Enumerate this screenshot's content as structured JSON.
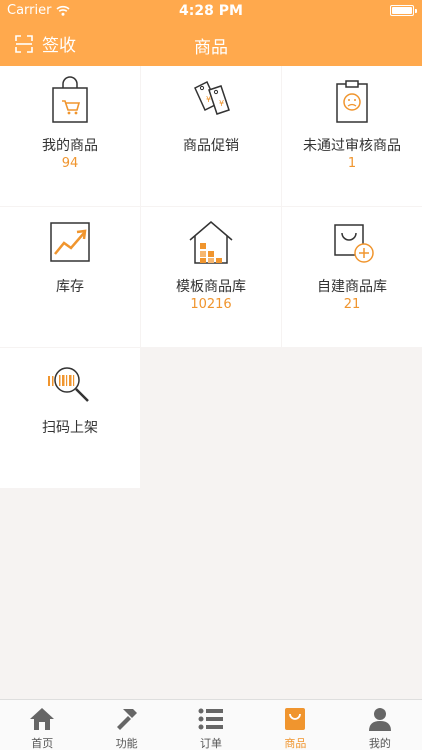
{
  "status_bar": {
    "carrier": "Carrier",
    "time": "4:28 PM"
  },
  "nav": {
    "scan_label": "签收",
    "title": "商品"
  },
  "grid": {
    "items": [
      {
        "label": "我的商品",
        "count": "94",
        "icon": "shopping-bag-icon"
      },
      {
        "label": "商品促销",
        "count": "",
        "icon": "price-tag-icon"
      },
      {
        "label": "未通过审核商品",
        "count": "1",
        "icon": "rejected-clipboard-icon"
      },
      {
        "label": "库存",
        "count": "",
        "icon": "stock-chart-icon"
      },
      {
        "label": "模板商品库",
        "count": "10216",
        "icon": "warehouse-icon"
      },
      {
        "label": "自建商品库",
        "count": "21",
        "icon": "add-bag-icon"
      },
      {
        "label": "扫码上架",
        "count": "",
        "icon": "barcode-scan-icon"
      }
    ]
  },
  "tabbar": {
    "items": [
      {
        "label": "首页",
        "icon": "home-icon"
      },
      {
        "label": "功能",
        "icon": "hammer-icon"
      },
      {
        "label": "订单",
        "icon": "list-icon"
      },
      {
        "label": "商品",
        "icon": "bag-icon"
      },
      {
        "label": "我的",
        "icon": "user-icon"
      }
    ],
    "active_index": 3
  },
  "colors": {
    "accent": "#ffa94d",
    "count_text": "#f0952e",
    "background": "#f6f3f2"
  }
}
